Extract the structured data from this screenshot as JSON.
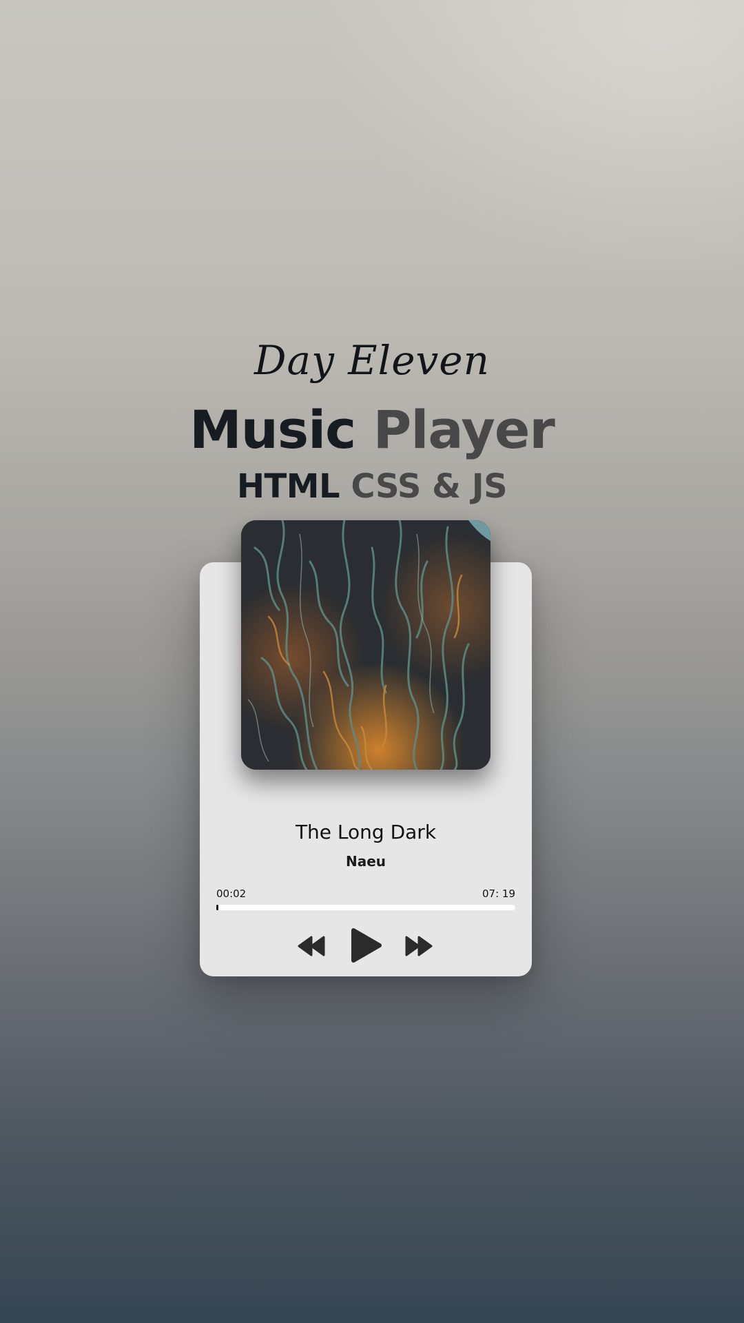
{
  "header": {
    "day": "Day Eleven",
    "title_part1": "Music",
    "title_part2": "Player",
    "subtitle_part1": "HTML",
    "subtitle_part2": "CSS & JS"
  },
  "player": {
    "cover_icon": "album-cover-image",
    "track_title": "The Long Dark",
    "artist": "Naeu",
    "current_time": "00:02",
    "total_time": "07: 19",
    "progress_fraction": 0.005,
    "controls": {
      "prev_icon": "rewind-icon",
      "play_icon": "play-icon",
      "next_icon": "fast-forward-icon"
    }
  },
  "colors": {
    "card_background": "#e6e6e7",
    "title_dark": "#161c22",
    "title_grey": "#484848",
    "progress_track": "#ffffff",
    "progress_fill": "#111111",
    "control_color": "#2b2b2b"
  }
}
